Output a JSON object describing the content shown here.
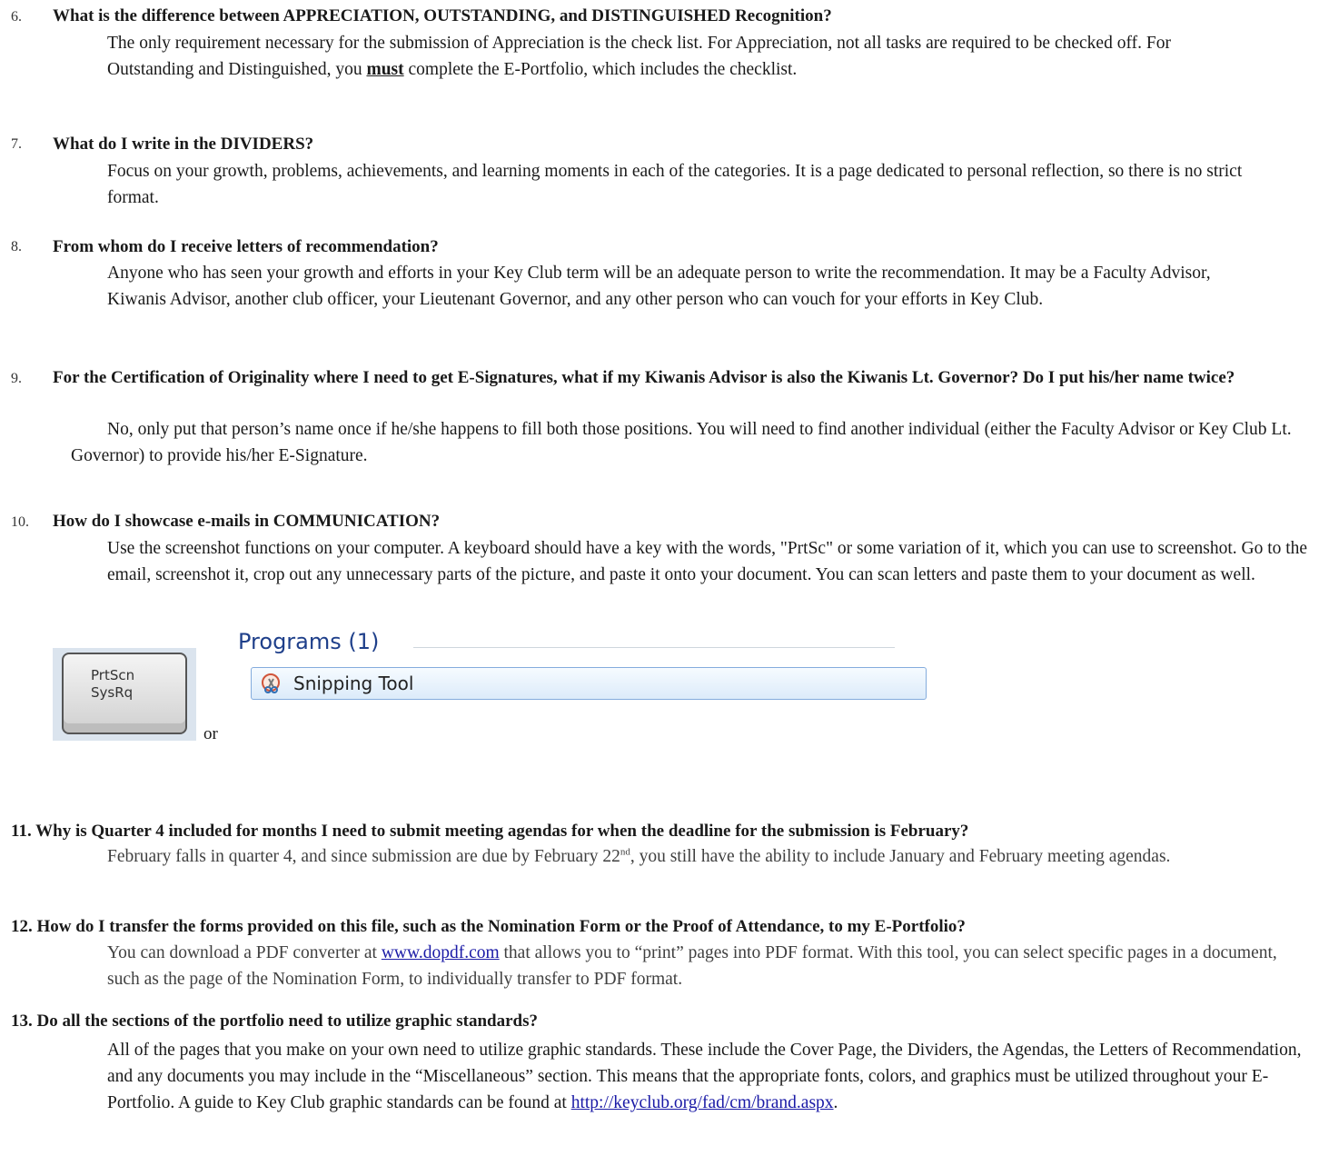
{
  "faq": [
    {
      "num": "6.",
      "q": "What is the difference between APPRECIATION, OUTSTANDING, and DISTINGUISHED Recognition?",
      "a_pre": "The only requirement necessary for the submission of Appreciation is the check list. For Appreciation, not all tasks are required to be checked off. For Outstanding and Distinguished, you ",
      "a_bold": "must",
      "a_post": " complete the E-Portfolio, which includes the checklist."
    },
    {
      "num": "7.",
      "q": "What do I write in the DIVIDERS?",
      "a": "Focus on your growth, problems, achievements, and learning moments in each of the categories. It is a page dedicated to personal reflection, so there is no strict format."
    },
    {
      "num": "8.",
      "q": "From whom do I receive letters of recommendation?",
      "a": "Anyone who has seen your growth and efforts in your Key Club term will be an adequate person to write the recommendation. It may be a Faculty Advisor, Kiwanis Advisor, another club officer, your Lieutenant Governor, and any other person who can vouch for your efforts in Key Club."
    },
    {
      "num": "9.",
      "q": "For the Certification of Originality where I need to get E-Signatures, what if my Kiwanis Advisor is also the Kiwanis Lt. Governor? Do I put his/her name twice?",
      "a": "No, only put that person’s name once if he/she happens to fill both those positions. You will need to find another individual (either the Faculty Advisor or Key Club Lt. Governor) to provide his/her E-Signature."
    },
    {
      "num": "10.",
      "q": "How do I showcase e-mails in COMMUNICATION?",
      "a": "Use the screenshot functions on your computer. A keyboard should have a key with the words, \"PrtSc\" or some variation of it, which you can use to screenshot. Go to the email, screenshot it, crop out any unnecessary parts of the picture, and paste it onto your document. You can scan letters and paste them to your document as well."
    },
    {
      "num": "11.",
      "q": "Why is Quarter 4 included for months I need to submit meeting agendas for when the deadline for the submission is February?",
      "a_pre": "February falls in quarter 4, and since submission are due by February 22",
      "a_sup": "nd",
      "a_post": ", you still have the ability to include January and February meeting agendas."
    },
    {
      "num": "12.",
      "q": "How do I transfer the forms provided on this file, such as the Nomination Form or the Proof of Attendance, to my E-Portfolio?",
      "a_pre": "You can download a PDF converter at ",
      "a_link": "www.dopdf.com",
      "a_post": " that allows you to “print” pages into PDF format. With this tool, you can select specific pages in a document, such as the page of the Nomination Form, to individually transfer to PDF format."
    },
    {
      "num": "13.",
      "q": "Do all the sections of the portfolio need to utilize graphic standards?",
      "a_pre": "All of the pages that you make on your own need to utilize graphic standards. These include the Cover Page, the Dividers, the Agendas, the Letters of Recommendation, and any documents you may include in the “Miscellaneous” section. This means that the appropriate fonts, colors, and graphics must be utilized throughout your E-Portfolio. A guide to Key Club graphic standards can be found at ",
      "a_link": "http://keyclub.org/fad/cm/brand.aspx",
      "a_post": "."
    }
  ],
  "images": {
    "key_label": "PrtScn\nSysRq",
    "or": "or",
    "programs_title": "Programs (1)",
    "snipping_label": "Snipping Tool"
  }
}
